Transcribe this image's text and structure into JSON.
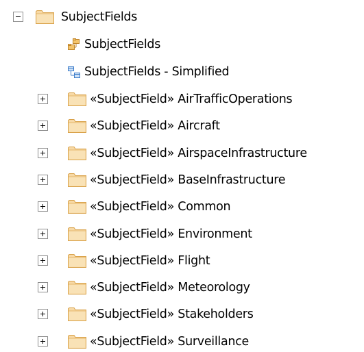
{
  "tree": {
    "root": {
      "label": "SubjectFields",
      "expander": "minus",
      "icon": "folder-icon"
    },
    "diagrams": [
      {
        "label": "SubjectFields",
        "icon": "package-diagram-icon"
      },
      {
        "label": "SubjectFields - Simplified",
        "icon": "class-diagram-icon"
      }
    ],
    "children": [
      {
        "stereotype": "«SubjectField»",
        "name": "AirTrafficOperations",
        "label": "«SubjectField» AirTrafficOperations",
        "expander": "plus",
        "icon": "folder-icon"
      },
      {
        "stereotype": "«SubjectField»",
        "name": "Aircraft",
        "label": "«SubjectField» Aircraft",
        "expander": "plus",
        "icon": "folder-icon"
      },
      {
        "stereotype": "«SubjectField»",
        "name": "AirspaceInfrastructure",
        "label": "«SubjectField» AirspaceInfrastructure",
        "expander": "plus",
        "icon": "folder-icon"
      },
      {
        "stereotype": "«SubjectField»",
        "name": "BaseInfrastructure",
        "label": "«SubjectField» BaseInfrastructure",
        "expander": "plus",
        "icon": "folder-icon"
      },
      {
        "stereotype": "«SubjectField»",
        "name": "Common",
        "label": "«SubjectField» Common",
        "expander": "plus",
        "icon": "folder-icon"
      },
      {
        "stereotype": "«SubjectField»",
        "name": "Environment",
        "label": "«SubjectField» Environment",
        "expander": "plus",
        "icon": "folder-icon"
      },
      {
        "stereotype": "«SubjectField»",
        "name": "Flight",
        "label": "«SubjectField» Flight",
        "expander": "plus",
        "icon": "folder-icon"
      },
      {
        "stereotype": "«SubjectField»",
        "name": "Meteorology",
        "label": "«SubjectField» Meteorology",
        "expander": "plus",
        "icon": "folder-icon"
      },
      {
        "stereotype": "«SubjectField»",
        "name": "Stakeholders",
        "label": "«SubjectField» Stakeholders",
        "expander": "plus",
        "icon": "folder-icon"
      },
      {
        "stereotype": "«SubjectField»",
        "name": "Surveillance",
        "label": "«SubjectField» Surveillance",
        "expander": "plus",
        "icon": "folder-icon"
      }
    ]
  },
  "colors": {
    "folder_fill": "#f7d9a6",
    "folder_border": "#d9a24a",
    "expander_border": "#8c8c8c",
    "diagram_icon_orange": "#e8a33b",
    "diagram_icon_blue": "#3a7ac8"
  }
}
